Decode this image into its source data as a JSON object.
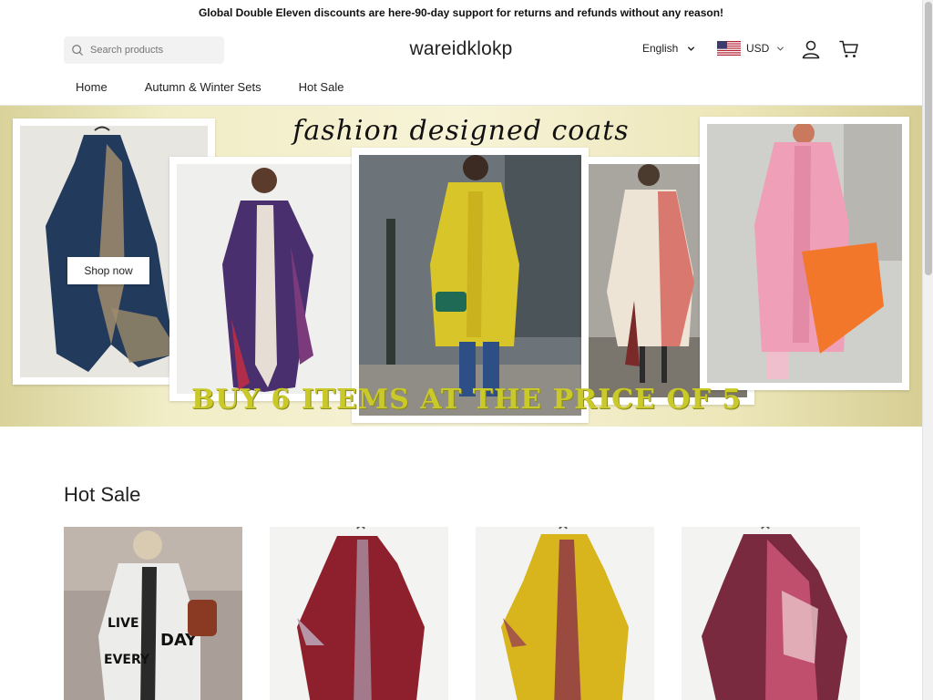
{
  "announcement": "Global Double Eleven discounts are here-90-day support for returns and refunds without any reason!",
  "header": {
    "search_placeholder": "Search products",
    "logo": "wareidklokp",
    "language": "English",
    "currency": "USD"
  },
  "nav": {
    "items": [
      "Home",
      "Autumn & Winter Sets",
      "Hot Sale"
    ]
  },
  "hero": {
    "title": "fashion designed coats",
    "shop_button": "Shop now",
    "promo": "BUY 6 ITEMS AT THE PRICE OF 5"
  },
  "hot_sale": {
    "title": "Hot Sale"
  },
  "colors": {
    "promo_text": "#c9c92a",
    "banner_bg": "#f1edc6"
  }
}
